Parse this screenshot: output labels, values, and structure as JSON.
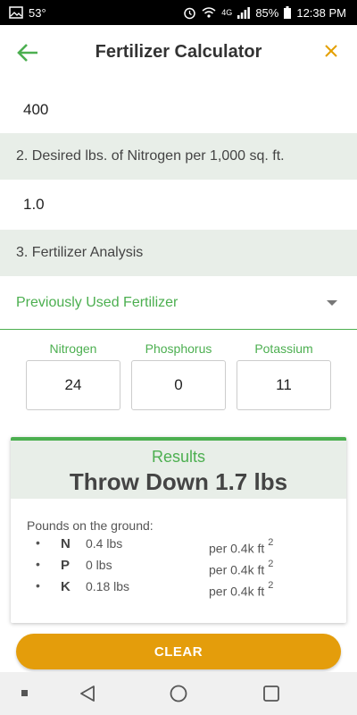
{
  "status_bar": {
    "temperature": "53°",
    "network": "4G",
    "battery": "85%",
    "time": "12:38 PM"
  },
  "app_bar": {
    "title": "Fertilizer Calculator",
    "back_icon": "arrow-left-icon",
    "close_icon": "close-icon",
    "accent_color": "#4caf50",
    "close_color": "#e4a000"
  },
  "form": {
    "area_value": "400",
    "nitrogen_label": "2. Desired lbs. of Nitrogen per 1,000 sq. ft.",
    "nitrogen_value": "1.0",
    "analysis_label": "3. Fertilizer Analysis",
    "fertilizer_select": "Previously Used Fertilizer",
    "npk": {
      "nitrogen_label": "Nitrogen",
      "nitrogen_value": "24",
      "phosphorus_label": "Phosphorus",
      "phosphorus_value": "0",
      "potassium_label": "Potassium",
      "potassium_value": "11"
    }
  },
  "results": {
    "title": "Results",
    "headline": "Throw Down 1.7 lbs",
    "pounds_label": "Pounds on the ground:",
    "bullet": "•",
    "rows": [
      {
        "letter": "N",
        "amount": "0.4 lbs",
        "per": "per 0.4k ft",
        "exp": "2"
      },
      {
        "letter": "P",
        "amount": "0 lbs",
        "per": "per 0.4k ft",
        "exp": "2"
      },
      {
        "letter": "K",
        "amount": "0.18 lbs",
        "per": "per 0.4k ft",
        "exp": "2"
      }
    ]
  },
  "clear_button": {
    "label": "CLEAR",
    "color": "#e49d0b"
  },
  "nav_bar": {
    "recents_icon": "recents-square-icon",
    "home_icon": "home-circle-icon",
    "back_icon": "back-triangle-icon",
    "menu_icon": "dot-menu-icon"
  }
}
